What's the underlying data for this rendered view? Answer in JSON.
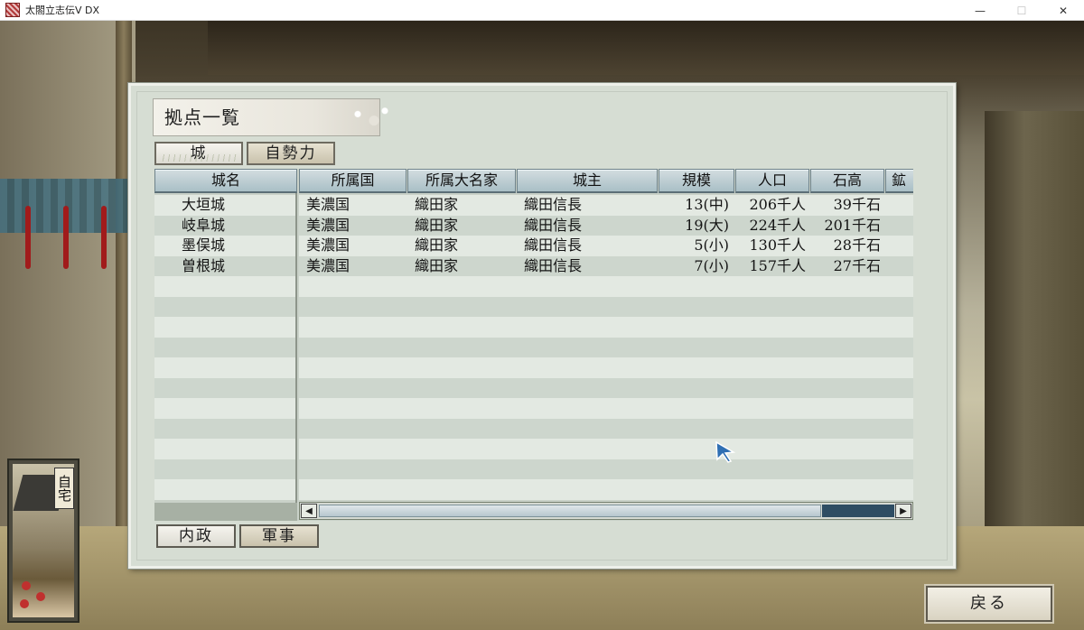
{
  "window": {
    "title": "太閤立志伝Ⅴ DX",
    "minimize": "—",
    "maximize": "☐",
    "close": "✕"
  },
  "home": {
    "label": "自宅"
  },
  "panel": {
    "title": "拠点一覧",
    "tabs": [
      {
        "label": "城",
        "selected": true
      },
      {
        "label": "自勢力",
        "selected": false
      }
    ],
    "columns": [
      "城名",
      "所属国",
      "所属大名家",
      "城主",
      "規模",
      "人口",
      "石高",
      "鉱"
    ],
    "rows": [
      {
        "name": "大垣城",
        "province": "美濃国",
        "clan": "織田家",
        "lord": "織田信長",
        "scale": "13(中)",
        "population": "206千人",
        "koku": "39千石"
      },
      {
        "name": "岐阜城",
        "province": "美濃国",
        "clan": "織田家",
        "lord": "織田信長",
        "scale": "19(大)",
        "population": "224千人",
        "koku": "201千石"
      },
      {
        "name": "墨俣城",
        "province": "美濃国",
        "clan": "織田家",
        "lord": "織田信長",
        "scale": "5(小)",
        "population": "130千人",
        "koku": "28千石"
      },
      {
        "name": "曽根城",
        "province": "美濃国",
        "clan": "織田家",
        "lord": "織田信長",
        "scale": "7(小)",
        "population": "157千人",
        "koku": "27千石"
      }
    ],
    "bottom_buttons": [
      {
        "label": "内政"
      },
      {
        "label": "軍事"
      }
    ],
    "scroll_left": "◀",
    "scroll_right": "▶"
  },
  "back_button": {
    "label": "戻る"
  },
  "colors": {
    "panel_bg": "#d6ddd3",
    "header_bg": "#a9bfc6",
    "scroll_thumb_dark": "#2e4d63",
    "cursor": "#2f6fb3"
  }
}
